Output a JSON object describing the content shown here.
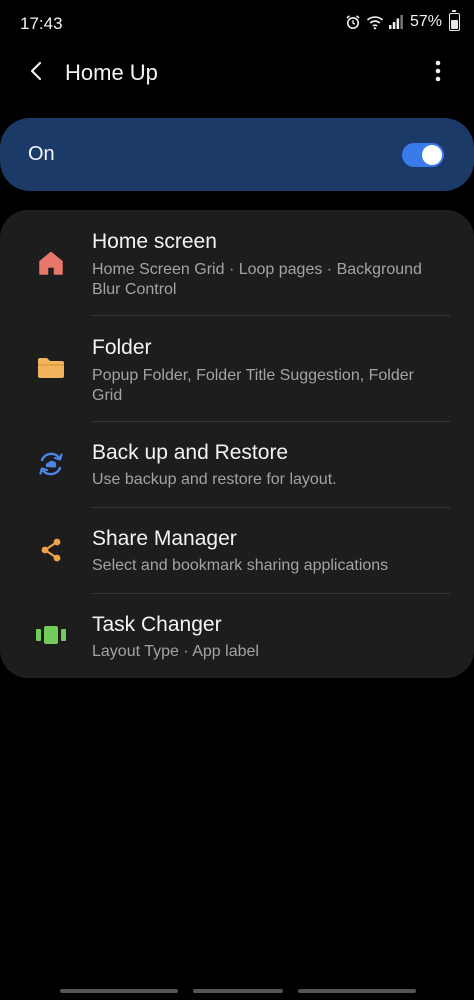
{
  "status": {
    "time": "17:43",
    "battery": "57%",
    "battery_level": 0.57,
    "icons": [
      "alarm-icon",
      "wifi-icon",
      "signal-icon",
      "battery-icon"
    ]
  },
  "app_bar": {
    "title": "Home Up",
    "back_icon": "back-arrow-icon",
    "more_icon": "more-vertical-icon"
  },
  "master_switch": {
    "label": "On",
    "checked": true,
    "accent": "#3a7bea",
    "background": "#1b3a67"
  },
  "items": [
    {
      "title": "Home screen",
      "subtitle": "Home Screen Grid · Loop pages · Background Blur Control",
      "icon": "home-icon",
      "color": "#e8776b"
    },
    {
      "title": "Folder",
      "subtitle": "Popup Folder, Folder Title Suggestion, Folder Grid",
      "icon": "folder-icon",
      "color": "#f2b45a"
    },
    {
      "title": "Back up and Restore",
      "subtitle": "Use backup and restore for layout.",
      "icon": "backup-restore-icon",
      "color": "#4d86e8"
    },
    {
      "title": "Share Manager",
      "subtitle": "Select and bookmark sharing applications",
      "icon": "share-icon",
      "color": "#f2a348"
    },
    {
      "title": "Task Changer",
      "subtitle": "Layout Type · App label",
      "icon": "task-changer-icon",
      "color": "#74cc5b"
    }
  ]
}
